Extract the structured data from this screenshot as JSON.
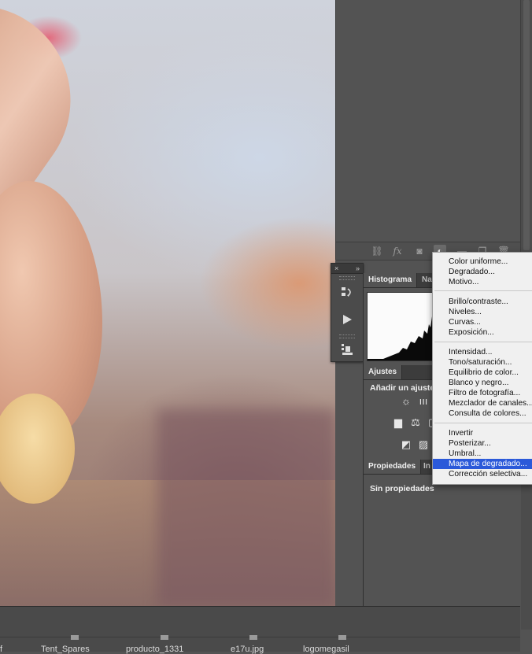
{
  "tool_palette": {
    "close_icon": "×",
    "collapse_icon": "»",
    "buttons": [
      "history-icon",
      "play-icon",
      "clone-source-icon"
    ]
  },
  "layers_toolbar": {
    "icons": [
      "link-icon",
      "fx-icon",
      "mask-icon",
      "adjustment-layer-icon",
      "folder-icon",
      "new-layer-icon",
      "trash-icon"
    ],
    "fx_label": "fx"
  },
  "histogram_panel": {
    "tabs": [
      "Histograma",
      "Nav"
    ]
  },
  "adjustments_panel": {
    "tab": "Ajustes",
    "title": "Añadir un ajuste"
  },
  "properties_panel": {
    "tabs": [
      "Propiedades",
      "In"
    ],
    "empty_text": "Sin propiedades"
  },
  "context_menu": {
    "groups": [
      [
        "Color uniforme...",
        "Degradado...",
        "Motivo..."
      ],
      [
        "Brillo/contraste...",
        "Niveles...",
        "Curvas...",
        "Exposición..."
      ],
      [
        "Intensidad...",
        "Tono/saturación...",
        "Equilibrio de color...",
        "Blanco y negro...",
        "Filtro de fotografía...",
        "Mezclador de canales...",
        "Consulta de colores..."
      ],
      [
        "Invertir",
        "Posterizar...",
        "Umbral...",
        "Mapa de degradado...",
        "Corrección selectiva..."
      ]
    ],
    "selected": "Mapa de degradado...",
    "colors": {
      "selection": "#2b59d9",
      "background": "#f0f0f0"
    }
  },
  "bottom_files": [
    "f",
    "Tent_Spares",
    "producto_1331",
    "e17u.jpg",
    "logomegasil"
  ]
}
